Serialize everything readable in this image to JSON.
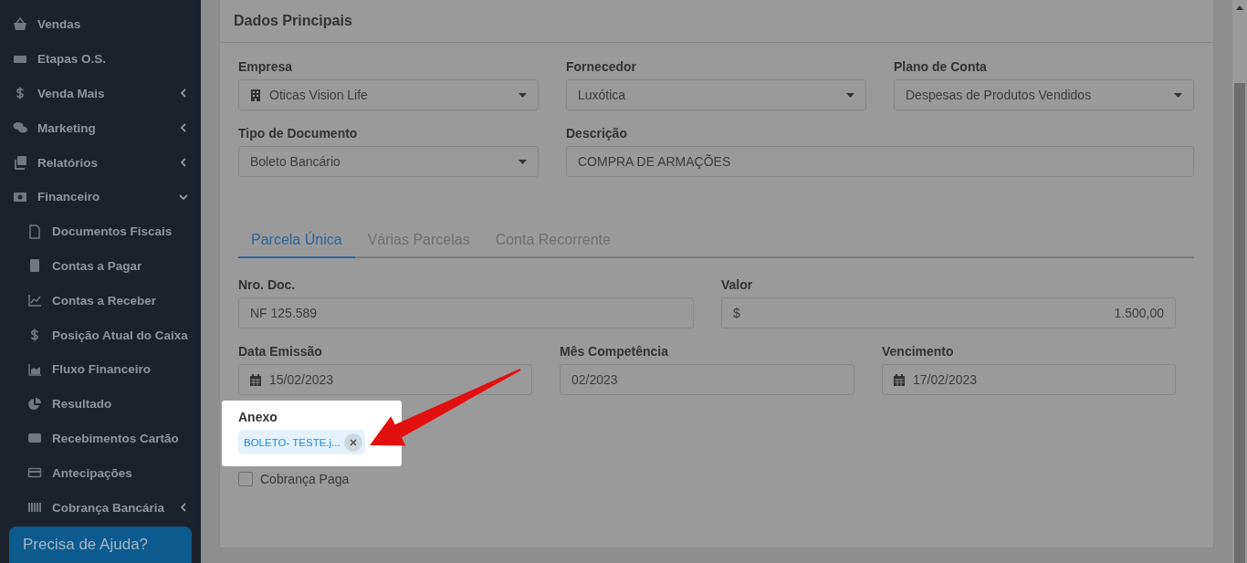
{
  "sidebar": {
    "items": [
      {
        "label": "Vendas"
      },
      {
        "label": "Etapas O.S."
      },
      {
        "label": "Venda Mais",
        "expanded": false
      },
      {
        "label": "Marketing",
        "expanded": false
      },
      {
        "label": "Relatórios",
        "expanded": false
      },
      {
        "label": "Financeiro",
        "expanded": true,
        "children": [
          {
            "label": "Documentos Fiscais"
          },
          {
            "label": "Contas a Pagar"
          },
          {
            "label": "Contas a Receber"
          },
          {
            "label": "Posição Atual do Caixa"
          },
          {
            "label": "Fluxo Financeiro"
          },
          {
            "label": "Resultado"
          },
          {
            "label": "Recebimentos Cartão"
          },
          {
            "label": "Antecipações"
          },
          {
            "label": "Cobrança Bancária",
            "expanded": false
          }
        ]
      }
    ]
  },
  "help_button": {
    "label": "Precisa de Ajuda?"
  },
  "card": {
    "title": "Dados Principais",
    "rows": [
      [
        {
          "label": "Empresa",
          "kind": "company",
          "value": "Oticas Vision Life"
        },
        {
          "label": "Fornecedor",
          "kind": "select",
          "value": "Luxótica"
        },
        {
          "label": "Plano de Conta",
          "kind": "select",
          "value": "Despesas de Produtos Vendidos"
        }
      ],
      [
        {
          "label": "Tipo de Documento",
          "kind": "select",
          "value": "Boleto Bancário"
        },
        {
          "label": "Descrição",
          "kind": "text",
          "value": "COMPRA DE ARMAÇÕES"
        }
      ]
    ],
    "tabs": [
      {
        "label": "Parcela Única",
        "selected": true
      },
      {
        "label": "Várias Parcelas",
        "selected": false
      },
      {
        "label": "Conta Recorrente",
        "selected": false
      }
    ],
    "tab_rows": [
      [
        {
          "label": "Nro. Doc.",
          "kind": "text",
          "value": "NF 125.589"
        },
        {
          "label": "Valor",
          "kind": "money",
          "prefix": "$",
          "value": "1.500,00"
        }
      ],
      [
        {
          "label": "Data Emissão",
          "kind": "date",
          "value": "15/02/2023"
        },
        {
          "label": "Mês Competência",
          "kind": "text",
          "value": "02/2023"
        },
        {
          "label": "Vencimento",
          "kind": "date",
          "value": "17/02/2023"
        }
      ]
    ],
    "attachment": {
      "label": "Anexo",
      "file": "BOLETO- TESTE.j..."
    },
    "checkbox": {
      "label": "Cobrança Paga",
      "checked": false
    }
  }
}
